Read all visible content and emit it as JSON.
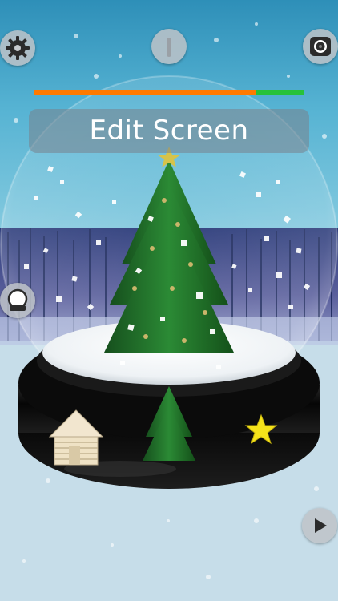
{
  "app": {
    "banner_text": "Edit Screen"
  },
  "progress": {
    "fraction": 0.82
  },
  "icons": {
    "settings": "gear-icon",
    "info": "info-icon",
    "camera": "camera-icon",
    "snow_globe": "snow-globe-icon",
    "play": "play-icon"
  },
  "base_items": [
    "log-cabin",
    "christmas-tree",
    "star"
  ],
  "colors": {
    "progress_orange": "#ff7a00",
    "progress_green": "#27c23a",
    "tree_green": "#1f6f2a",
    "base_black": "#101010",
    "star_yellow": "#f4e21a"
  }
}
